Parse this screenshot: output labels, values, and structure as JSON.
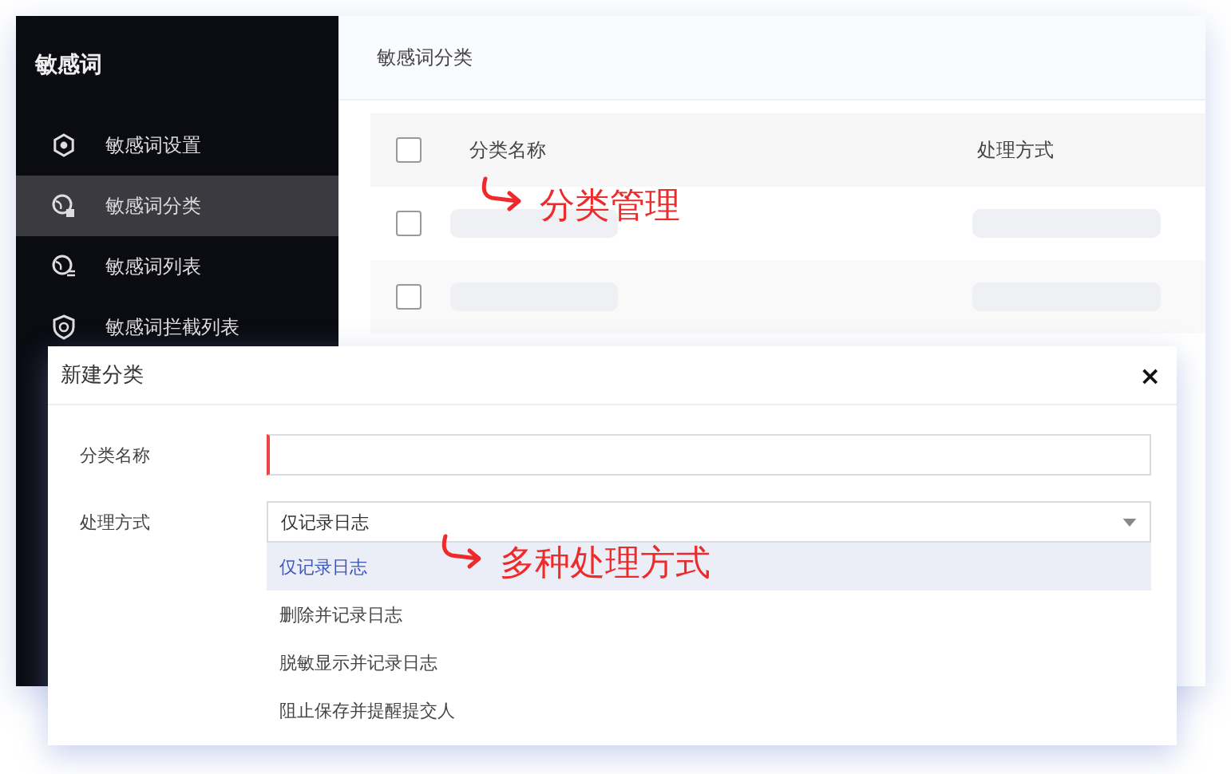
{
  "sidebar": {
    "title": "敏感词",
    "items": [
      {
        "label": "敏感词设置",
        "selected": false
      },
      {
        "label": "敏感词分类",
        "selected": true
      },
      {
        "label": "敏感词列表",
        "selected": false
      },
      {
        "label": "敏感词拦截列表",
        "selected": false
      }
    ]
  },
  "main": {
    "title": "敏感词分类",
    "table": {
      "columns": [
        "分类名称",
        "处理方式"
      ],
      "all_checked": false,
      "rows": [
        {
          "checked": false
        },
        {
          "checked": false
        }
      ]
    }
  },
  "dialog": {
    "title": "新建分类",
    "close": "×",
    "fields": [
      {
        "label": "分类名称",
        "kind": "text"
      },
      {
        "label": "处理方式",
        "kind": "select",
        "value": "仅记录日志",
        "options": [
          {
            "label": "仅记录日志",
            "selected": true
          },
          {
            "label": "删除并记录日志",
            "selected": false
          },
          {
            "label": "脱敏显示并记录日志",
            "selected": false
          },
          {
            "label": "阻止保存并提醒提交人",
            "selected": false
          }
        ]
      }
    ]
  },
  "annotations": [
    "分类管理",
    "多种处理方式"
  ]
}
